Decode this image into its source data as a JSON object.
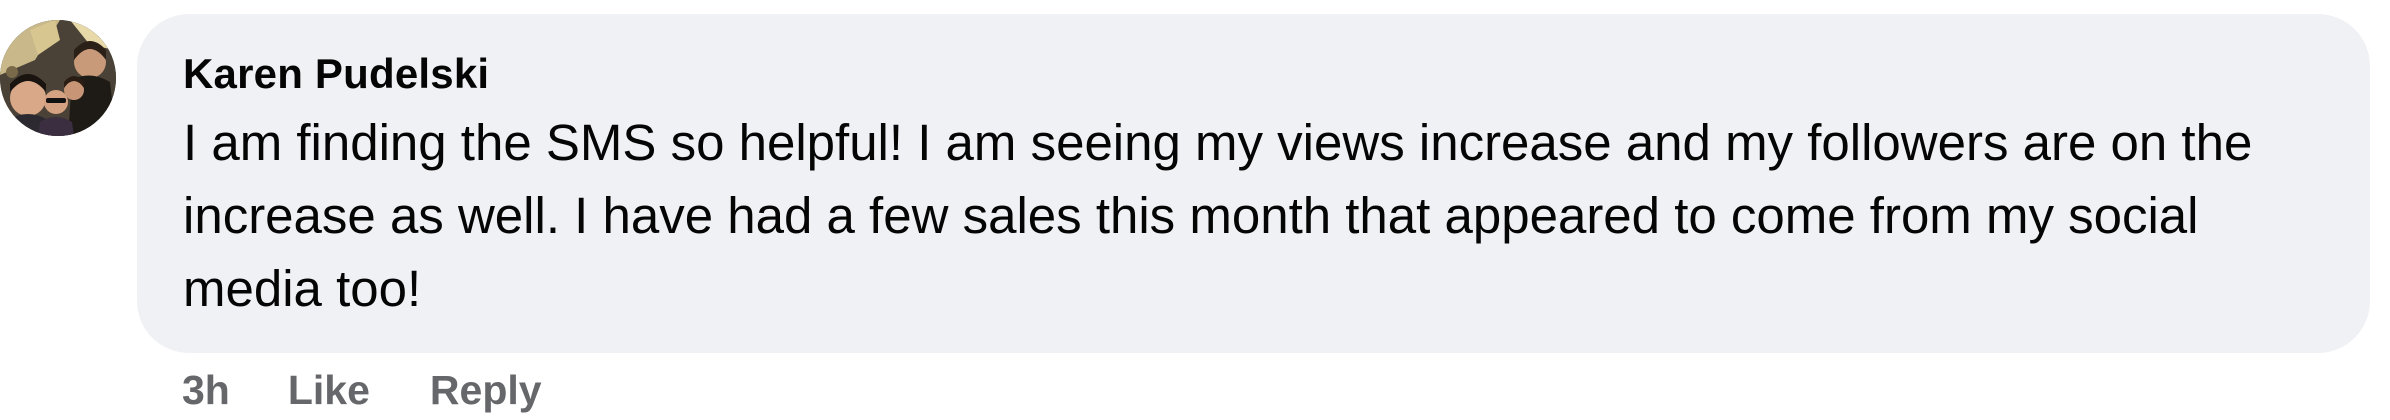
{
  "comment": {
    "author": "Karen Pudelski",
    "text": "I am finding the SMS so helpful! I am seeing my views increase and my followers are on the increase as well. I have had a few sales this month that appeared to come from my social media too!",
    "timestamp": "3h",
    "like_label": "Like",
    "reply_label": "Reply",
    "avatar_icon": "profile-photo"
  },
  "colors": {
    "bubble": "#f0f1f5",
    "text": "#050505",
    "meta": "#65676b"
  }
}
